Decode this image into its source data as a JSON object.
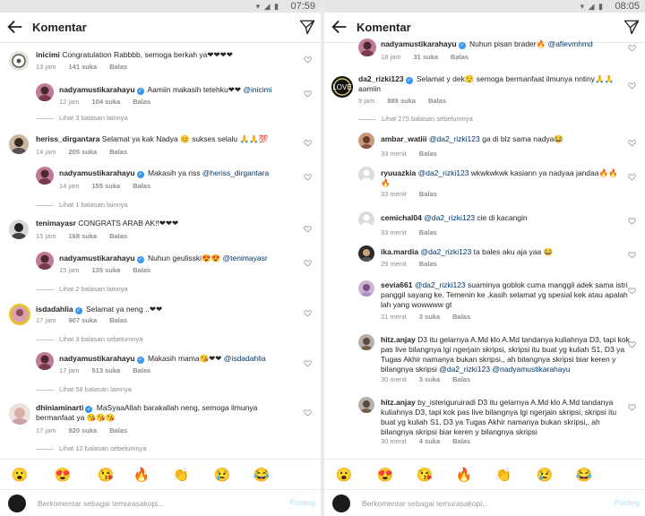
{
  "left": {
    "time": "07:59",
    "title": "Komentar",
    "comments": [
      {
        "user": "inicimi",
        "text": "Congratulation Rabbbb, semoga berkah ya❤❤❤❤",
        "time": "13 jam",
        "likes": "141 suka",
        "reply": "Balas"
      },
      {
        "user": "nadyamustikarahayu",
        "text": "Aamiin makasih tetehku❤❤",
        "mention": "@inicimi",
        "time": "12 jam",
        "likes": "104 suka",
        "reply": "Balas"
      },
      {
        "user": "heriss_dirgantara",
        "text": "Selamat ya kak Nadya 😊 sukses selalu 🙏🙏💯",
        "time": "14 jam",
        "likes": "205 suka",
        "reply": "Balas"
      },
      {
        "user": "nadyamustikarahayu",
        "text": "Makasih ya riss",
        "mention": "@heriss_dirgantara",
        "time": "14 jam",
        "likes": "155 suka",
        "reply": "Balas"
      },
      {
        "user": "tenimayasr",
        "text": "CONGRATS ARAB AK!!❤❤❤",
        "time": "15 jam",
        "likes": "168 suka",
        "reply": "Balas"
      },
      {
        "user": "nadyamustikarahayu",
        "text": "Nuhun geulisski😍😍",
        "mention": "@tenimayasr",
        "time": "15 jam",
        "likes": "135 suka",
        "reply": "Balas"
      },
      {
        "user": "isdadahlia",
        "text": "Selamat ya neng ..❤❤",
        "time": "17 jam",
        "likes": "907 suka",
        "reply": "Balas"
      },
      {
        "user": "nadyamustikarahayu",
        "text": "Makasih mama😘❤❤",
        "mention": "@isdadahlia",
        "time": "17 jam",
        "likes": "513 suka",
        "reply": "Balas"
      },
      {
        "user": "dhiniaminarti",
        "text": "MaSyaaAllah barakallah neng, semoga ilmunya bermanfaat ya 😘😘😘",
        "time": "17 jam",
        "likes": "920 suka",
        "reply": "Balas"
      }
    ],
    "view_replies": [
      "Lihat 3 balasan lainnya",
      "Lihat 1 balasan lainnya",
      "Lihat 2 balasan lainnya",
      "Lihat 3 balasan sebelumnya",
      "Lihat 58 balasan lainnya",
      "Lihat 12 balasan sebelumnya"
    ],
    "input_placeholder": "Berkomentar sebagai temurasakopi...",
    "post_label": "Posting"
  },
  "right": {
    "time": "08:05",
    "title": "Komentar",
    "comments": [
      {
        "user": "nadyamustikarahayu",
        "text": "Nuhun pisan brader🔥",
        "mention": "@afievmhmd",
        "time": "18 jam",
        "likes": "31 suka",
        "reply": "Balas"
      },
      {
        "user": "da2_rizki123",
        "text": "Selamat y dek😌 semoga bermanfaat ilmunya nntiny🙏🙏 aamiin",
        "time": "9 jam",
        "likes": "889 suka",
        "reply": "Balas"
      },
      {
        "user": "ambar_watiii",
        "text": "ga di blz sama nadya😂",
        "mention": "@da2_rizki123",
        "time": "33 menit",
        "likes": "",
        "reply": "Balas"
      },
      {
        "user": "ryuuazkia",
        "text": "wkwkwkwk kasiann ya nadyaa jandaa🔥🔥🔥",
        "mention": "@da2_rizki123",
        "time": "33 menit",
        "likes": "",
        "reply": "Balas"
      },
      {
        "user": "cemichal04",
        "text": "cie di kacangin",
        "mention": "@da2_rizki123",
        "time": "33 menit",
        "likes": "",
        "reply": "Balas"
      },
      {
        "user": "ika.mardia",
        "text": "ta bales aku aja yaa 😂",
        "mention": "@da2_rizki123",
        "time": "29 menit",
        "likes": "",
        "reply": "Balas"
      },
      {
        "user": "sevia661",
        "text": "suaminya goblok cuma manggil adek sama istri panggil sayang ke. Temenin ke ,kasih selamat yg spesial kek atau apalah lah yang wowwww gt",
        "mention": "@da2_rizki123",
        "time": "31 menit",
        "likes": "3 suka",
        "reply": "Balas"
      },
      {
        "user": "hitz.anjay",
        "text": "D3 itu gelarnya A.Md klo A.Md tandanya kuliahnya D3, tapi kok pas live bilangnya lgi ngerjain skripsi, skripsi itu buat yg kuliah S1, D3 ya Tugas Akhir namanya bukan skripsi,, ah bilangnya skripsi biar keren y bilangnya skripsi",
        "mention": "@da2_rizki123",
        "mention2": "@nadyamustikarahayu",
        "time": "30 menit",
        "likes": "3 suka",
        "reply": "Balas"
      },
      {
        "user": "hitz.anjay",
        "text": "by_isteriguruiradi D3 itu gelarnya A.Md klo A.Md tandanya kuliahnya D3, tapi kok pas live bilangnya lgi ngerjain skripsi, skripsi itu buat yg kuliah S1, D3 ya Tugas Akhir namanya bukan skripsi,, ah bilangnya skripsi biar keren y bilangnya skripsi",
        "time": "30 menit",
        "likes": "4 suka",
        "reply": "Balas"
      }
    ],
    "view_replies": [
      "Lihat 275 balasan sebelumnya"
    ],
    "input_placeholder": "Berkomentar sebagai temurasakopi...",
    "post_label": "Posting"
  },
  "emojis": [
    "😮",
    "😍",
    "😘",
    "🔥",
    "👏",
    "😢",
    "😂"
  ],
  "colors": {
    "link": "#00376b",
    "verified": "#3897f0",
    "post_disabled": "#b2dffc",
    "meta": "#8e8e8e"
  },
  "icons": [
    "back-arrow-icon",
    "send-icon",
    "heart-icon",
    "verified-badge-icon"
  ]
}
